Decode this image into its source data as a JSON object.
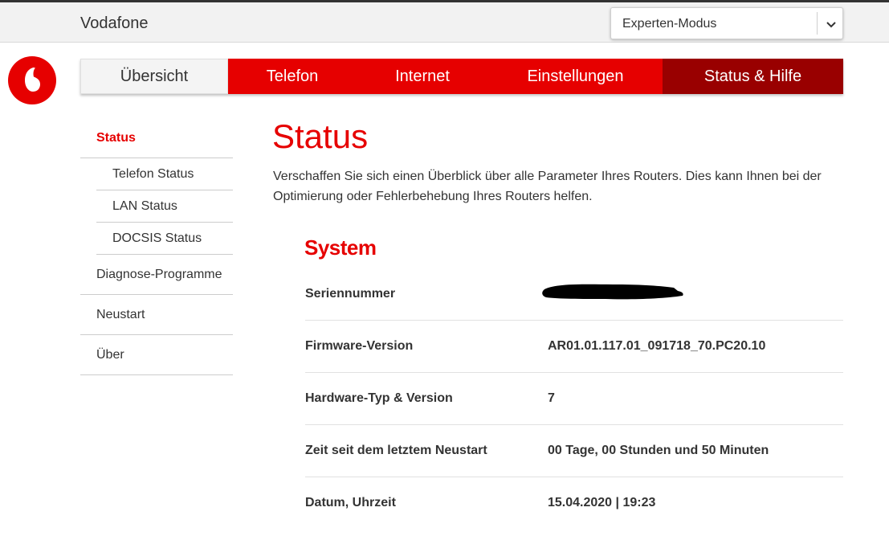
{
  "header": {
    "brand": "Vodafone",
    "mode_select": {
      "value": "Experten-Modus"
    }
  },
  "logo": {
    "icon": "vodafone-logo-icon",
    "color": "#e60000"
  },
  "nav": {
    "items": [
      {
        "label": "Übersicht"
      },
      {
        "label": "Telefon"
      },
      {
        "label": "Internet"
      },
      {
        "label": "Einstellungen"
      },
      {
        "label": "Status & Hilfe"
      }
    ],
    "active_index": 4
  },
  "sidebar": {
    "items": [
      {
        "label": "Status"
      },
      {
        "label": "Telefon Status"
      },
      {
        "label": "LAN Status"
      },
      {
        "label": "DOCSIS Status"
      },
      {
        "label": "Diagnose-Programme"
      },
      {
        "label": "Neustart"
      },
      {
        "label": "Über"
      }
    ]
  },
  "main": {
    "title": "Status",
    "intro": "Verschaffen Sie sich einen Überblick über alle Parameter Ihres Routers. Dies kann Ihnen bei der Optimierung oder Fehlerbehebung Ihres Routers helfen.",
    "section_title": "System",
    "rows": [
      {
        "label": "Seriennummer",
        "value": ""
      },
      {
        "label": "Firmware-Version",
        "value": "AR01.01.117.01_091718_70.PC20.10"
      },
      {
        "label": "Hardware-Typ & Version",
        "value": "7"
      },
      {
        "label": "Zeit seit dem letztem Neustart",
        "value": "00 Tage, 00 Stunden und 50 Minuten"
      },
      {
        "label": "Datum, Uhrzeit",
        "value": "15.04.2020 | 19:23"
      }
    ]
  },
  "colors": {
    "brand_red": "#e60000",
    "active_red": "#990000"
  }
}
